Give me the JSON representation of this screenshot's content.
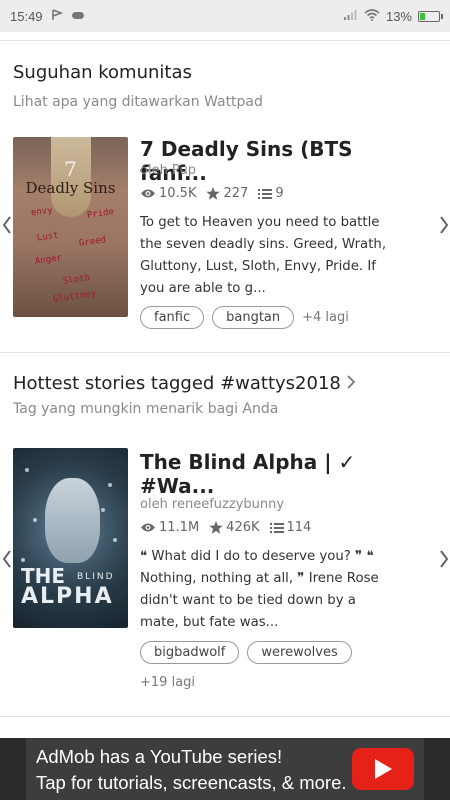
{
  "status_bar": {
    "time": "15:49",
    "battery": "13%",
    "icons": [
      "flag-icon",
      "cloud-icon",
      "signal-icon",
      "wifi-icon",
      "battery-icon"
    ]
  },
  "section1": {
    "title": "Suguhan komunitas",
    "subtitle": "Lihat apa yang ditawarkan Wattpad"
  },
  "story1": {
    "title": "7 Deadly Sins (BTS fanf...",
    "author": "oleh Pup",
    "reads": "10.5K",
    "votes": "227",
    "parts": "9",
    "description": "To get to Heaven you need to battle the seven deadly sins. Greed, Wrath, Gluttony, Lust, Sloth, Envy, Pride. If you are able to g...",
    "tags": [
      "fanfic",
      "bangtan"
    ],
    "more_tags": "+4 lagi",
    "cover_title": "7 Deadly Sins",
    "cover_words": [
      "envy",
      "Pride",
      "Lust",
      "Greed",
      "Anger",
      "Sloth",
      "Gluttony"
    ]
  },
  "section2": {
    "title": "Hottest stories tagged #wattys2018",
    "subtitle": "Tag yang mungkin menarik bagi Anda"
  },
  "story2": {
    "title_line1": "The Blind Alpha | ✓",
    "title_line2": "#Wa...",
    "author": "oleh reneefuzzybunny",
    "reads": "11.1M",
    "votes": "426K",
    "parts": "114",
    "description": "❝ What did I do to deserve you? ❞ ❝ Nothing, nothing at all, ❞ Irene Rose didn't want to be tied down by a mate, but fate was...",
    "tags": [
      "bigbadwolf",
      "werewolves"
    ],
    "more_tags": "+19 lagi",
    "cover_the": "THE",
    "cover_blind": "BLIND",
    "cover_alpha": "ALPHA"
  },
  "ad": {
    "line1": "AdMob has a YouTube series!",
    "line2": "Tap for tutorials, screencasts, & more."
  },
  "colors": {
    "ad_background": "#3d3d3d",
    "youtube_red": "#e62117",
    "tag_border": "#9a9a9a",
    "divider": "#e2e2e2"
  }
}
